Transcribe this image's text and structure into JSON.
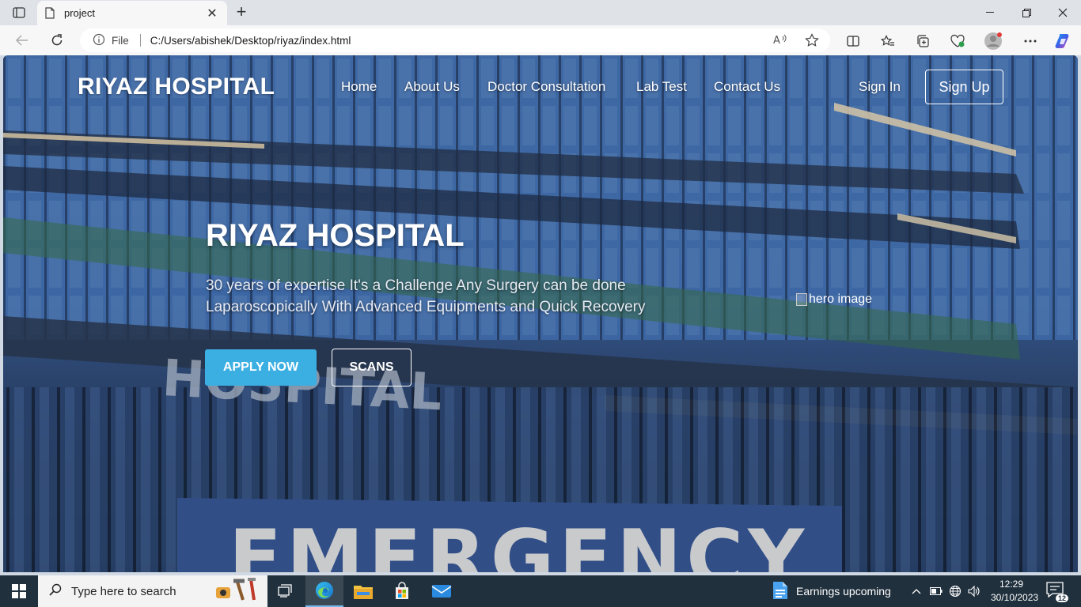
{
  "browser": {
    "tab_title": "project",
    "address": {
      "scheme_label": "File",
      "url": "C:/Users/abishek/Desktop/riyaz/index.html"
    }
  },
  "site": {
    "logo": "RIYAZ HOSPITAL",
    "nav": [
      "Home",
      "About Us",
      "Doctor Consultation",
      "Lab Test",
      "Contact Us"
    ],
    "sign_in": "Sign In",
    "sign_up": "Sign Up",
    "hero": {
      "title": "RIYAZ HOSPITAL",
      "description": "30 years of expertise It's a Challenge Any Surgery can be done Laparoscopically With Advanced Equipments and Quick Recovery",
      "apply_button": "APPLY NOW",
      "scans_button": "SCANS",
      "image_alt": "hero image"
    },
    "colors": {
      "apply_button": "#3cafe2",
      "text": "#ffffff"
    }
  },
  "taskbar": {
    "search_placeholder": "Type here to search",
    "widget_label": "Earnings upcoming",
    "time": "12:29",
    "date": "30/10/2023",
    "notification_count": "12"
  }
}
